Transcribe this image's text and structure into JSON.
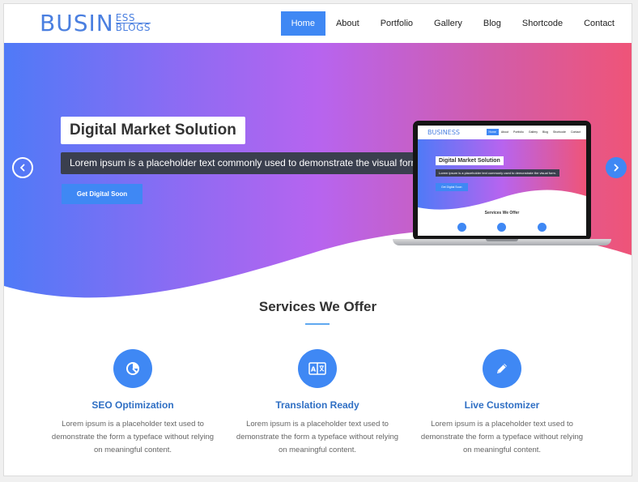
{
  "brand": {
    "logo_main": "BUSIN",
    "logo_top": "ESS",
    "logo_bottom": "BLOGS",
    "accent": "#3f88f4"
  },
  "nav": {
    "items": [
      {
        "label": "Home",
        "active": true
      },
      {
        "label": "About"
      },
      {
        "label": "Portfolio"
      },
      {
        "label": "Gallery"
      },
      {
        "label": "Blog"
      },
      {
        "label": "Shortcode"
      },
      {
        "label": "Contact"
      }
    ]
  },
  "hero": {
    "title": "Digital Market Solution",
    "subtitle": "Lorem ipsum is a placeholder text commonly used to demonstrate the visual form.",
    "button": "Get Digital Soon",
    "prev_icon": "chevron-left-icon",
    "next_icon": "chevron-right-icon"
  },
  "laptop_preview": {
    "logo": "BUSINESS",
    "nav": [
      "Home",
      "About",
      "Portfolio",
      "Gallery",
      "Blog",
      "Shortcode",
      "Contact"
    ],
    "title": "Digital Market Solution",
    "subtitle": "Lorem ipsum is a placeholder text commonly used to demonstrate the visual form.",
    "button": "Get Digital Soon",
    "services": "Services We Offer"
  },
  "services": {
    "heading": "Services We Offer",
    "items": [
      {
        "title": "SEO Optimization",
        "desc": "Lorem ipsum is a placeholder text used to demonstrate the form a typeface without relying on meaningful content.",
        "icon": "chart-pie-icon"
      },
      {
        "title": "Translation Ready",
        "desc": "Lorem ipsum is a placeholder text used to demonstrate the form a typeface without relying on meaningful content.",
        "icon": "translate-icon"
      },
      {
        "title": "Live Customizer",
        "desc": "Lorem ipsum is a placeholder text used to demonstrate the form a typeface without relying on meaningful content.",
        "icon": "pencil-icon"
      }
    ]
  }
}
